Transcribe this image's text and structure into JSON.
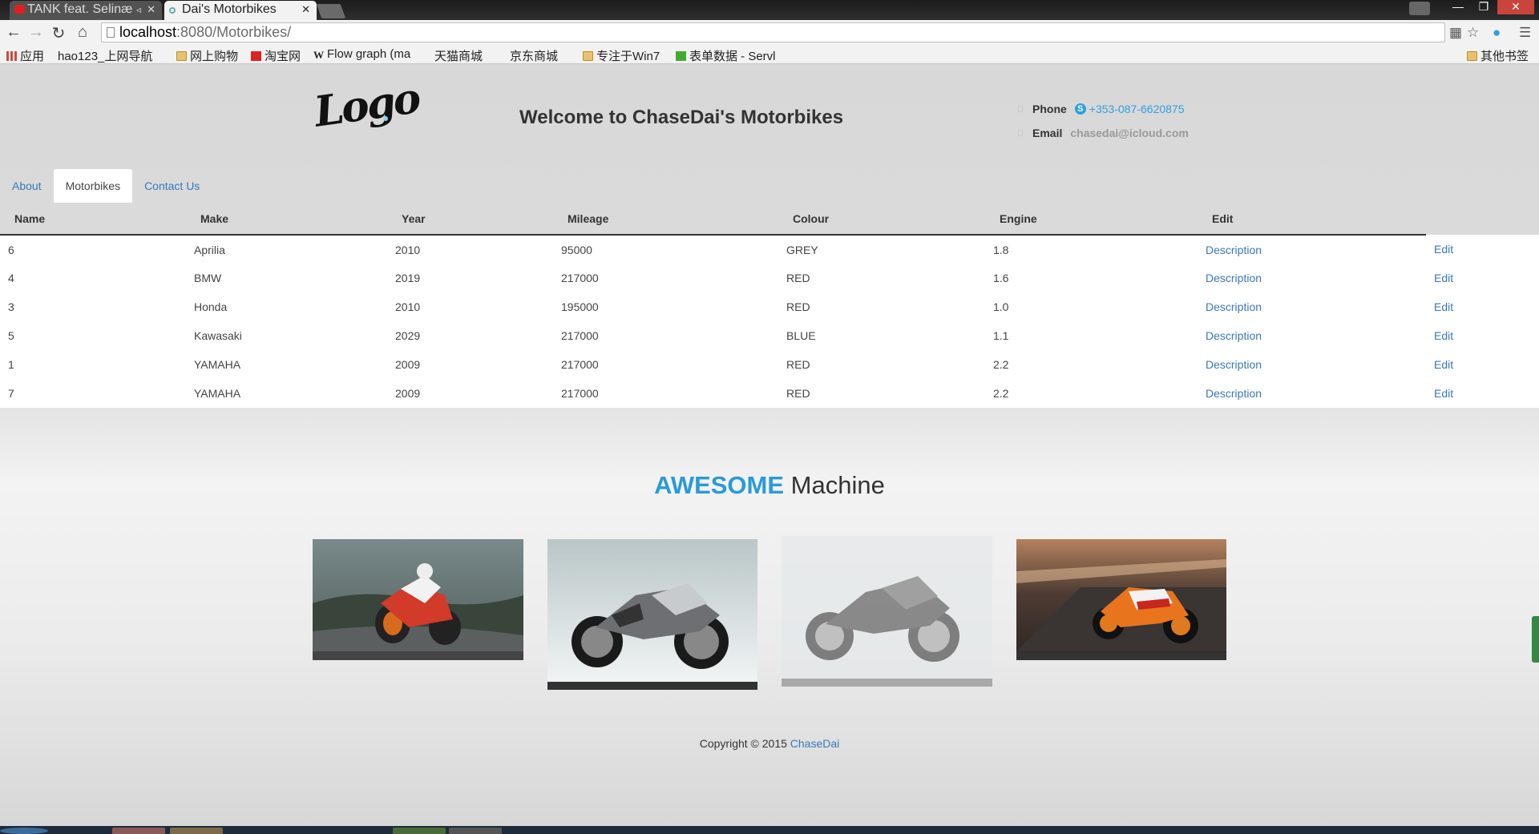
{
  "browser": {
    "tabs": [
      {
        "title": "TANK feat. Selinæ",
        "active": false
      },
      {
        "title": "Dai's Motorbikes",
        "active": true
      }
    ],
    "url_host": "localhost",
    "url_path": ":8080/Motorbikes/",
    "bookmarks": [
      {
        "label": "应用",
        "icon": "apps-grid-icon"
      },
      {
        "label": "hao123_上网导航",
        "icon": "page-icon"
      },
      {
        "label": "网上购物",
        "icon": "folder-icon"
      },
      {
        "label": "淘宝网",
        "icon": "taobao-icon"
      },
      {
        "label": "Flow graph (ma",
        "icon": "wikipedia-icon"
      },
      {
        "label": "天猫商城",
        "icon": "page-icon"
      },
      {
        "label": "京东商城",
        "icon": "page-icon"
      },
      {
        "label": "专注于Win7",
        "icon": "folder-icon"
      },
      {
        "label": "表单数据 - Servl",
        "icon": "form-icon"
      }
    ],
    "other_bookmarks": "其他书签"
  },
  "header": {
    "logo_text": "Logo",
    "welcome": "Welcome to ChaseDai's Motorbikes",
    "phone_label": "Phone",
    "phone_value": "+353-087-6620875",
    "email_label": "Email",
    "email_value": "chasedai@icloud.com"
  },
  "nav": {
    "items": [
      "About",
      "Motorbikes",
      "Contact Us"
    ],
    "active": "Motorbikes"
  },
  "table": {
    "headers": [
      "Name",
      "Make",
      "Year",
      "Mileage",
      "Colour",
      "Engine",
      "Edit"
    ],
    "description_label": "Description",
    "edit_label": "Edit",
    "rows": [
      {
        "name": "6",
        "make": "Aprilia",
        "year": "2010",
        "mileage": "95000",
        "colour": "GREY",
        "engine": "1.8"
      },
      {
        "name": "4",
        "make": "BMW",
        "year": "2019",
        "mileage": "217000",
        "colour": "RED",
        "engine": "1.6"
      },
      {
        "name": "3",
        "make": "Honda",
        "year": "2010",
        "mileage": "195000",
        "colour": "RED",
        "engine": "1.0"
      },
      {
        "name": "5",
        "make": "Kawasaki",
        "year": "2029",
        "mileage": "217000",
        "colour": "BLUE",
        "engine": "1.1"
      },
      {
        "name": "1",
        "make": "YAMAHA",
        "year": "2009",
        "mileage": "217000",
        "colour": "RED",
        "engine": "2.2"
      },
      {
        "name": "7",
        "make": "YAMAHA",
        "year": "2009",
        "mileage": "217000",
        "colour": "RED",
        "engine": "2.2"
      }
    ]
  },
  "showcase": {
    "title_highlight": "AWESOME",
    "title_rest": " Machine"
  },
  "footer": {
    "copyright": "Copyright © 2015 ",
    "brand": "ChaseDai"
  },
  "colors": {
    "accent": "#2a9bd6",
    "link": "#3a78b8"
  }
}
